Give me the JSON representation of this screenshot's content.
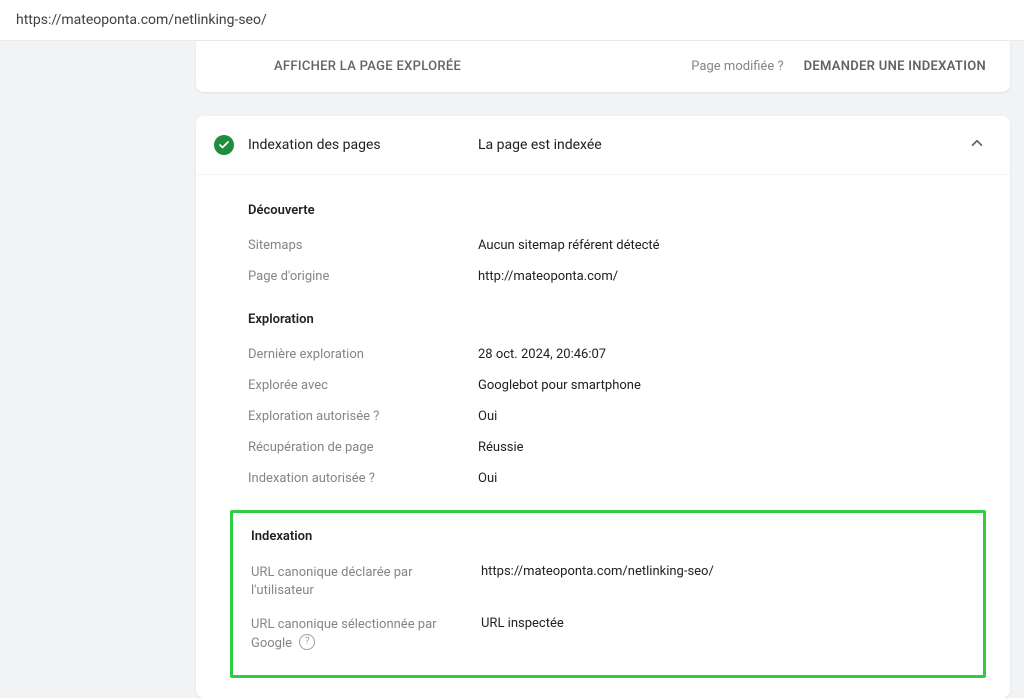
{
  "url_bar": "https://mateoponta.com/netlinking-seo/",
  "top": {
    "view_crawled": "AFFICHER LA PAGE EXPLORÉE",
    "page_modified": "Page modifiée ?",
    "request_index": "DEMANDER UNE INDEXATION"
  },
  "card": {
    "title": "Indexation des pages",
    "status": "La page est indexée"
  },
  "sections": {
    "discovery": {
      "heading": "Découverte",
      "sitemaps_label": "Sitemaps",
      "sitemaps_value": "Aucun sitemap référent détecté",
      "origin_label": "Page d'origine",
      "origin_value": "http://mateoponta.com/"
    },
    "crawl": {
      "heading": "Exploration",
      "last_crawl_label": "Dernière exploration",
      "last_crawl_value": "28 oct. 2024, 20:46:07",
      "crawled_as_label": "Explorée avec",
      "crawled_as_value": "Googlebot pour smartphone",
      "crawl_allowed_label": "Exploration autorisée ?",
      "crawl_allowed_value": "Oui",
      "page_fetch_label": "Récupération de page",
      "page_fetch_value": "Réussie",
      "index_allowed_label": "Indexation autorisée ?",
      "index_allowed_value": "Oui"
    },
    "indexing": {
      "heading": "Indexation",
      "user_canonical_label": "URL canonique déclarée par l'utilisateur",
      "user_canonical_value": "https://mateoponta.com/netlinking-seo/",
      "google_canonical_label": "URL canonique sélectionnée par Google",
      "google_canonical_value": "URL inspectée"
    }
  }
}
